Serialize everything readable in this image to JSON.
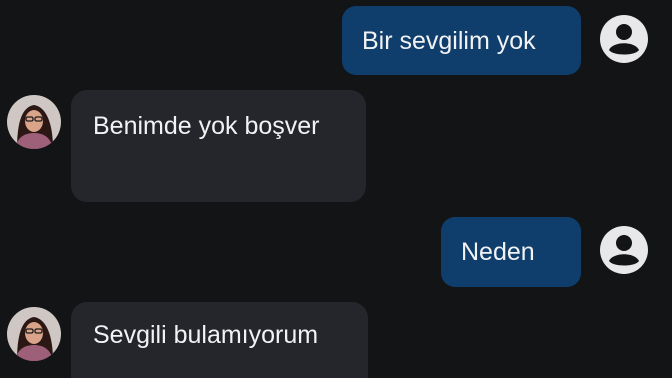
{
  "chat": {
    "messages": [
      {
        "direction": "sent",
        "text": "Bir sevgilim yok"
      },
      {
        "direction": "received",
        "text": "Benimde yok boşver"
      },
      {
        "direction": "sent",
        "text": "Neden"
      },
      {
        "direction": "received",
        "text": "Sevgili bulamıyorum"
      }
    ]
  },
  "icons": {
    "own_avatar": "user-avatar-icon",
    "contact_avatar": "contact-photo"
  },
  "colors": {
    "background": "#131416",
    "sent_bubble": "#0f3e6c",
    "received_bubble": "#24262b",
    "message_text": "#f1f2f4",
    "own_avatar": "#e8e8ea"
  }
}
